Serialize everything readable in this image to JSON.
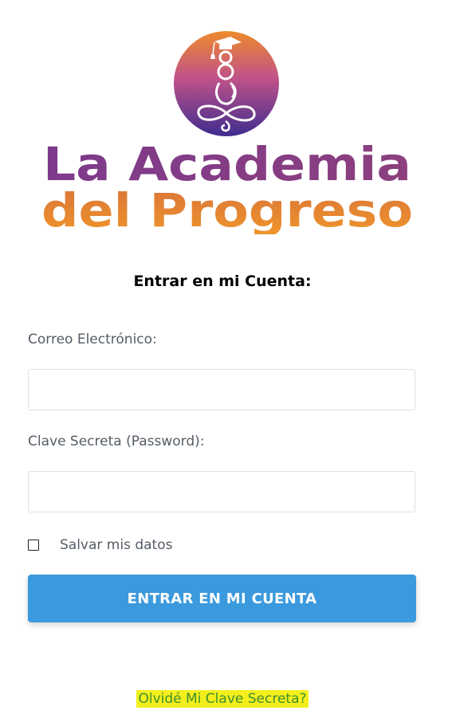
{
  "brand": {
    "line1": "La Academia",
    "line2": "del Progreso",
    "logo_icon": "meditating-figure-graduation-cap-icon",
    "colors": {
      "purple": "#7a3b8c",
      "orange": "#e8872e",
      "emblem_top": "#e8812f",
      "emblem_bottom": "#4a2a8a"
    }
  },
  "login": {
    "title": "Entrar en mi Cuenta:",
    "email_label": "Correo Electrónico:",
    "email_value": "",
    "password_label": "Clave Secreta (Password):",
    "password_value": "",
    "remember_label": "Salvar mis datos",
    "remember_checked": false,
    "submit_label": "ENTRAR EN MI CUENTA",
    "forgot_label": "Olvidé Mi Clave Secreta?"
  },
  "colors": {
    "button_bg": "#3b99dd",
    "link_highlight": "#f4ef1c",
    "link_text": "#3d8f2e"
  }
}
